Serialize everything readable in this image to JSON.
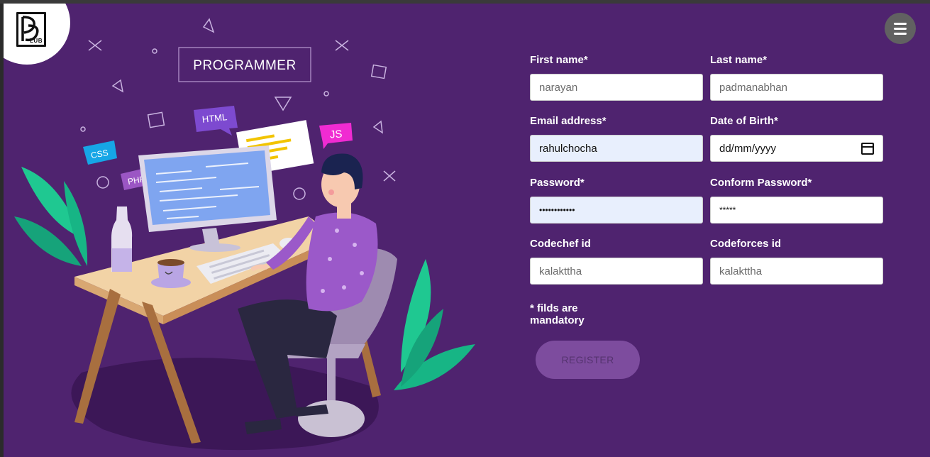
{
  "brand": {
    "logo_text": "LUB"
  },
  "illustration": {
    "banner_label": "PROGRAMMER",
    "tags": {
      "html": "HTML",
      "css": "CSS",
      "php": "PHP",
      "js": "JS"
    }
  },
  "form": {
    "first_name": {
      "label": "First name*",
      "value": "narayan"
    },
    "last_name": {
      "label": "Last name*",
      "value": "padmanabhan"
    },
    "email": {
      "label": "Email address*",
      "value": "rahulchocha"
    },
    "dob": {
      "label": "Date of Birth*",
      "value": "dd/mm/yyyy"
    },
    "password": {
      "label": "Password*",
      "value": "••••••••••••"
    },
    "confirm_password": {
      "label": "Conform Password*",
      "value": "*****"
    },
    "codechef": {
      "label": "Codechef id",
      "value": "kalakttha"
    },
    "codeforces": {
      "label": "Codeforces id",
      "value": "kalakttha"
    },
    "note": "* filds are mandatory",
    "register_label": "REGISTER"
  },
  "colors": {
    "background": "#4f236f",
    "button": "#7d4c9e",
    "accent_green": "#1fc891"
  }
}
